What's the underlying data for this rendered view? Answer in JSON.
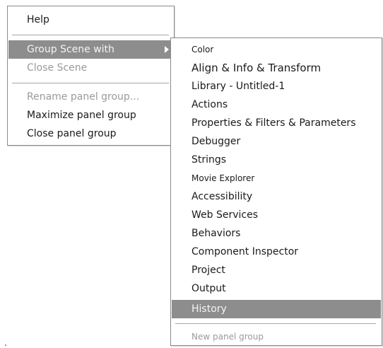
{
  "main_menu": {
    "help": "Help",
    "group_scene_with": "Group Scene with",
    "close_scene": "Close Scene",
    "rename_panel_group": "Rename panel group...",
    "maximize_panel_group": "Maximize panel group",
    "close_panel_group": "Close panel group"
  },
  "submenu": {
    "items": [
      "Color",
      "Align & Info & Transform",
      "Library - Untitled-1",
      "Actions",
      "Properties & Filters & Parameters",
      "Debugger",
      "Strings",
      "Movie Explorer",
      "Accessibility",
      "Web Services",
      "Behaviors",
      "Component Inspector",
      "Project",
      "Output",
      "History"
    ],
    "new_panel_group": "New panel group"
  },
  "colors": {
    "highlight": "#8d8d8d",
    "disabled_text": "#9a9a9a",
    "text": "#1a1a1a"
  },
  "icons": {
    "submenu_arrow": "triangle-right-icon"
  }
}
